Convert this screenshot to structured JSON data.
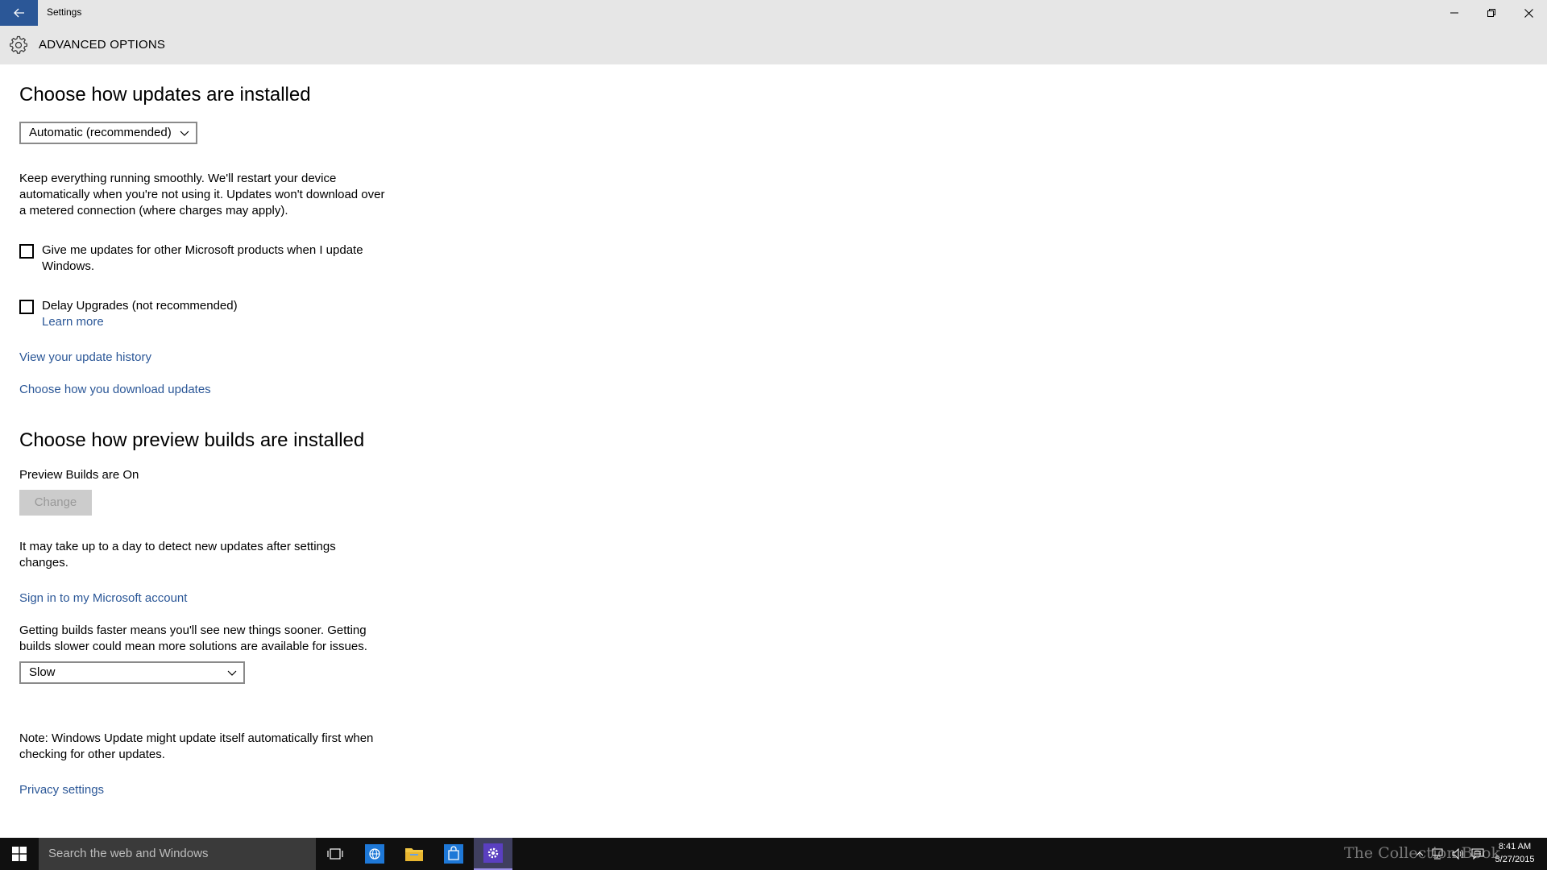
{
  "window": {
    "title": "Settings",
    "controls": [
      "minimize",
      "restore",
      "close"
    ]
  },
  "header": {
    "icon": "gear-icon",
    "title": "ADVANCED OPTIONS"
  },
  "section1": {
    "heading": "Choose how updates are installed",
    "install_dropdown": {
      "selected": "Automatic (recommended)"
    },
    "description": "Keep everything running smoothly. We'll restart your device automatically when you're not using it. Updates won't download over a metered connection (where charges may apply).",
    "checkbox_other_products": {
      "label": "Give me updates for other Microsoft products when I update Windows.",
      "checked": false
    },
    "checkbox_delay": {
      "label": "Delay Upgrades (not recommended)",
      "checked": false
    },
    "learn_more": "Learn more",
    "link_history": "View your update history",
    "link_download": "Choose how you download updates"
  },
  "section2": {
    "heading": "Choose how preview builds are installed",
    "status": "Preview Builds are On",
    "change_button": "Change",
    "note_detect": "It may take up to a day to detect new updates after settings changes.",
    "link_signin": "Sign in to my Microsoft account",
    "speed_desc": "Getting builds faster means you'll see new things sooner. Getting builds slower could mean more solutions are available for issues.",
    "speed_dropdown": {
      "selected": "Slow"
    },
    "note_update": "Note: Windows Update might update itself automatically first when checking for other updates.",
    "link_privacy": "Privacy settings"
  },
  "taskbar": {
    "search_placeholder": "Search the web and Windows",
    "watermark": "The Collection Book",
    "time": "8:41 AM",
    "date": "5/27/2015"
  },
  "colors": {
    "accent": "#2b5797",
    "titlebar": "#e6e6e6",
    "taskbar": "#101010"
  }
}
